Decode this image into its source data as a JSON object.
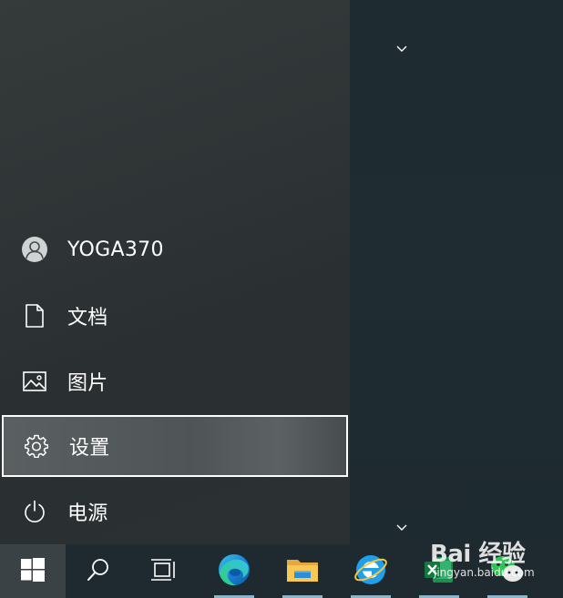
{
  "start_menu": {
    "items": [
      {
        "id": "user",
        "label": "YOGA370",
        "icon": "user-avatar-icon"
      },
      {
        "id": "documents",
        "label": "文档",
        "icon": "document-icon"
      },
      {
        "id": "pictures",
        "label": "图片",
        "icon": "picture-icon"
      },
      {
        "id": "settings",
        "label": "设置",
        "icon": "gear-icon",
        "selected": true
      },
      {
        "id": "power",
        "label": "电源",
        "icon": "power-icon"
      }
    ]
  },
  "taskbar": {
    "buttons": [
      {
        "id": "start",
        "icon": "windows-logo-icon"
      },
      {
        "id": "search",
        "icon": "search-icon"
      },
      {
        "id": "task-view",
        "icon": "task-view-icon"
      },
      {
        "id": "edge",
        "icon": "edge-browser-icon"
      },
      {
        "id": "file-explorer",
        "icon": "folder-icon"
      },
      {
        "id": "internet-explorer",
        "icon": "ie-icon"
      },
      {
        "id": "excel",
        "icon": "excel-icon"
      },
      {
        "id": "wechat",
        "icon": "wechat-icon"
      }
    ]
  },
  "watermark": {
    "main": "Bai 经验",
    "sub": "jingyan.baidu.com"
  },
  "colors": {
    "accent_underline": "#8fb4c8",
    "menu_bg": "#2f3536",
    "tiles_bg": "#1e2b31",
    "taskbar_bg": "#1e2a2f",
    "selected_border": "#ffffff"
  }
}
